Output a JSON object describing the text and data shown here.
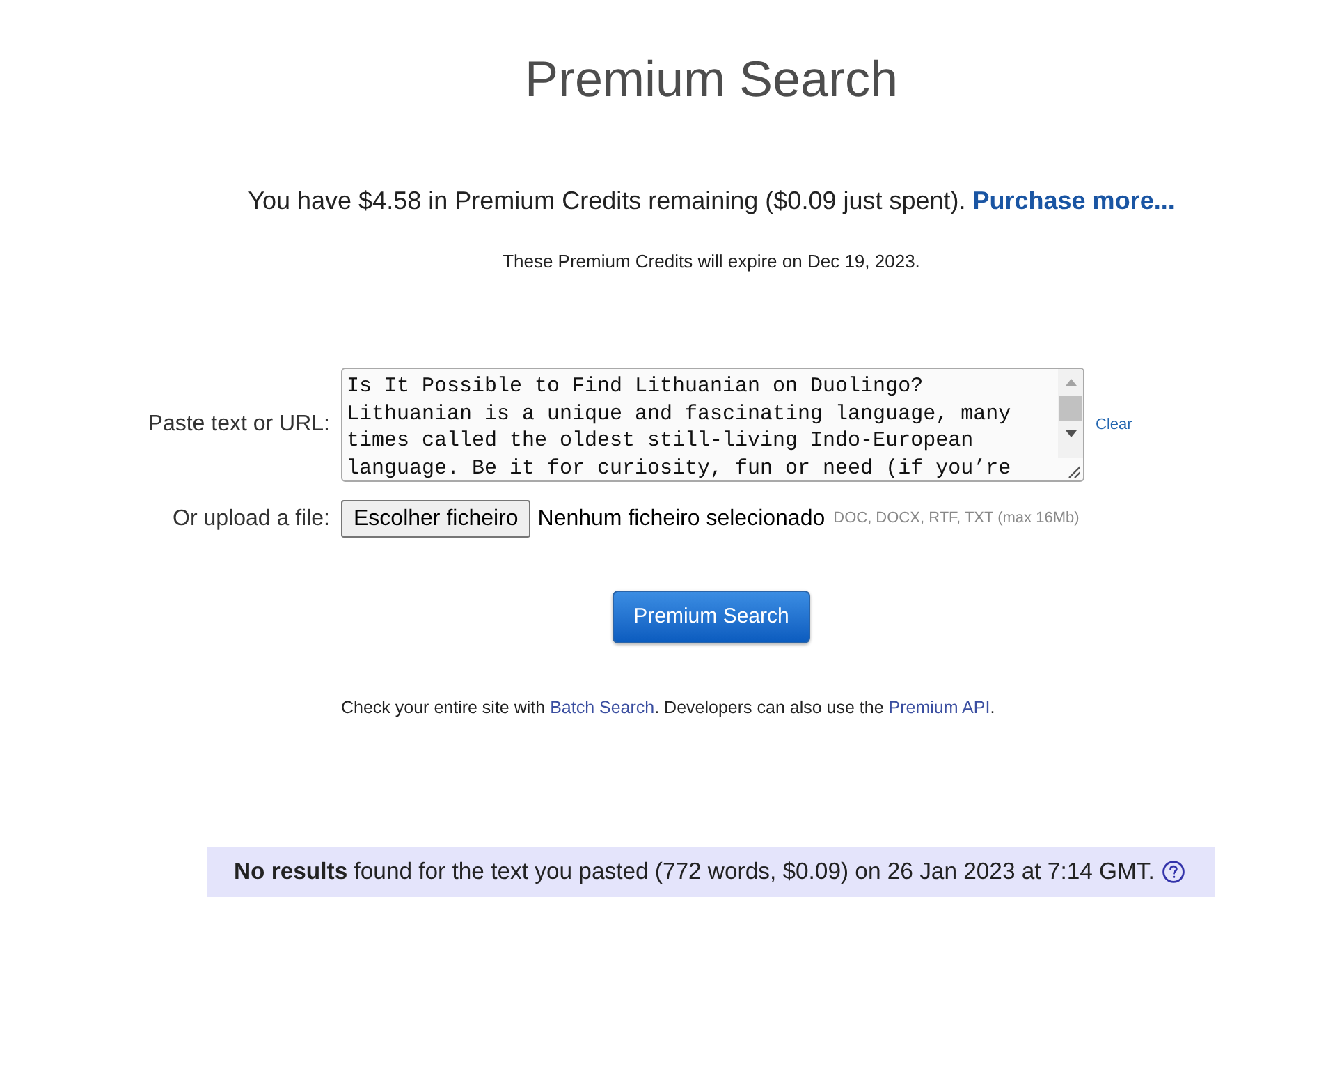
{
  "title": "Premium Search",
  "credits": {
    "parts": [
      {
        "kind": "text",
        "text": "You have $4.58 in Premium Credits remaining ($0.09 just spent). "
      },
      {
        "kind": "link",
        "text": "Purchase more..."
      }
    ],
    "expiry": "These Premium Credits will expire on Dec 19, 2023."
  },
  "paste": {
    "label": "Paste text or URL:",
    "value": "Is It Possible to Find Lithuanian on Duolingo?\nLithuanian is a unique and fascinating language, many times called the oldest still-living Indo-European language. Be it for curiosity, fun or need (if you’re",
    "clear": "Clear"
  },
  "upload": {
    "label": "Or upload a file:",
    "button": "Escolher ficheiro",
    "status": "Nenhum ficheiro selecionado",
    "hint": "DOC, DOCX, RTF, TXT (max 16Mb)"
  },
  "search_button": "Premium Search",
  "footer": {
    "parts": [
      {
        "kind": "text",
        "text": "Check your entire site with "
      },
      {
        "kind": "link",
        "text": "Batch Search"
      },
      {
        "kind": "text",
        "text": ". Developers can also use the "
      },
      {
        "kind": "link",
        "text": "Premium API"
      },
      {
        "kind": "text",
        "text": "."
      }
    ]
  },
  "result": {
    "text": "**No results** found for the text you pasted (772 words, $0.09) on 26 Jan 2023 at 7:14 GMT."
  }
}
